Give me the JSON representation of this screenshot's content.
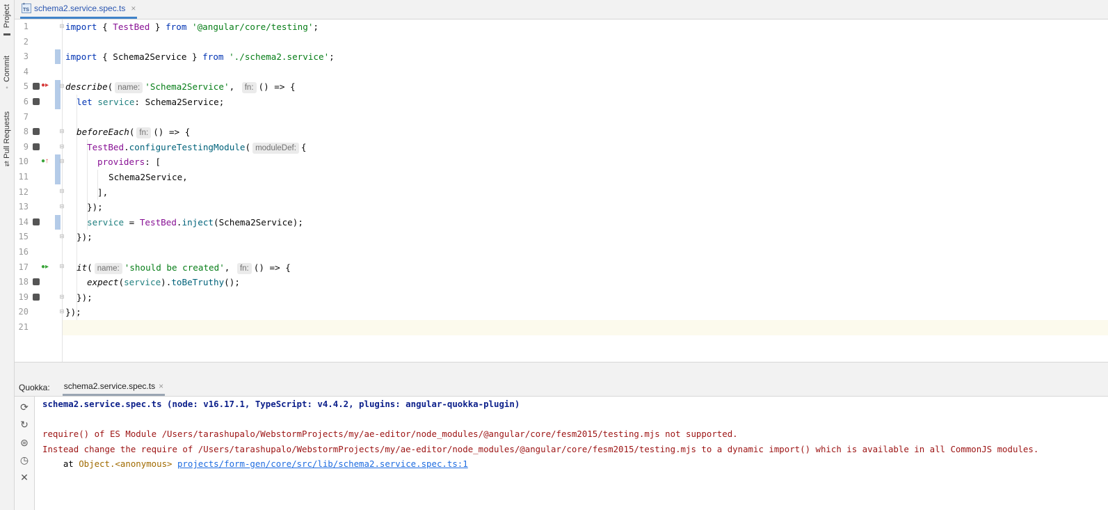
{
  "sidebar": {
    "items": [
      {
        "label": "Project",
        "icon": "folder-icon"
      },
      {
        "label": "Commit",
        "icon": "commit-icon"
      },
      {
        "label": "Pull Requests",
        "icon": "pull-request-icon"
      }
    ]
  },
  "editor_tab": {
    "icon_text_top": "*",
    "icon_text_bottom": "TS",
    "label": "schema2.service.spec.ts",
    "close_glyph": "×"
  },
  "code": {
    "line_numbers": [
      "1",
      "2",
      "3",
      "4",
      "5",
      "6",
      "7",
      "8",
      "9",
      "10",
      "11",
      "12",
      "13",
      "14",
      "15",
      "16",
      "17",
      "18",
      "19",
      "20",
      "21"
    ],
    "l1": {
      "kw1": "import",
      "p1": " { ",
      "cls": "TestBed",
      "p2": " } ",
      "kw2": "from",
      "p3": " ",
      "str": "'@angular/core/testing'",
      "p4": ";"
    },
    "l3": {
      "kw1": "import",
      "p1": " { Schema2Service } ",
      "kw2": "from",
      "p3": " ",
      "str": "'./schema2.service'",
      "p4": ";"
    },
    "l5": {
      "fn": "describe",
      "p1": "(",
      "hint1": "name:",
      "str": "'Schema2Service'",
      "p2": ", ",
      "hint2": "fn:",
      "p3": "() => {"
    },
    "l6": {
      "kw": "let",
      "p1": " ",
      "var": "service",
      "p2": ": Schema2Service;"
    },
    "l8": {
      "fn": "beforeEach",
      "p1": "(",
      "hint": "fn:",
      "p2": "() => {"
    },
    "l9": {
      "cls": "TestBed",
      "p1": ".",
      "fn": "configureTestingModule",
      "p2": "(",
      "hint": "moduleDef:",
      "p3": "{"
    },
    "l10": {
      "prop": "providers",
      "p1": ": ["
    },
    "l11": {
      "text": "Schema2Service,"
    },
    "l12": {
      "text": "],"
    },
    "l13": {
      "text": "});"
    },
    "l14": {
      "var": "service",
      "p1": " = ",
      "cls": "TestBed",
      "p2": ".",
      "fn": "inject",
      "p3": "(Schema2Service);"
    },
    "l15": {
      "text": "});"
    },
    "l17": {
      "fn": "it",
      "p1": "(",
      "hint1": "name:",
      "str": "'should be created'",
      "p2": ", ",
      "hint2": "fn:",
      "p3": "() => {"
    },
    "l18": {
      "fn1": "expect",
      "p1": "(",
      "var": "service",
      "p2": ").",
      "fn2": "toBeTruthy",
      "p3": "();"
    },
    "l19": {
      "text": "});"
    },
    "l20": {
      "text": "});"
    }
  },
  "quokka": {
    "title": "Quokka:",
    "tab_label": "schema2.service.spec.ts",
    "tab_close": "×",
    "toolbar": [
      "rerun-icon",
      "refresh-icon",
      "coverage-icon",
      "history-icon",
      "close-icon"
    ],
    "output": {
      "header": "schema2.service.spec.ts (node: v16.17.1, TypeScript: v4.4.2, plugins: angular-quokka-plugin)",
      "error_line1": "require() of ES Module /Users/tarashupalo/WebstormProjects/my/ae-editor/node_modules/@angular/core/fesm2015/testing.mjs not supported.",
      "error_line2": "Instead change the require of /Users/tarashupalo/WebstormProjects/my/ae-editor/node_modules/@angular/core/fesm2015/testing.mjs to a dynamic import() which is available in all CommonJS modules.",
      "at_prefix": "    at ",
      "at_object": "Object.<anonymous>",
      "at_space": " ",
      "at_link": "projects/form-gen/core/src/lib/schema2.service.spec.ts:1"
    }
  },
  "colors": {
    "keyword": "#0033b3",
    "string": "#067d17",
    "class": "#871094",
    "function": "#00627a",
    "error": "#9c1313",
    "link": "#1e6ce0",
    "tab_accent": "#4083c9"
  }
}
